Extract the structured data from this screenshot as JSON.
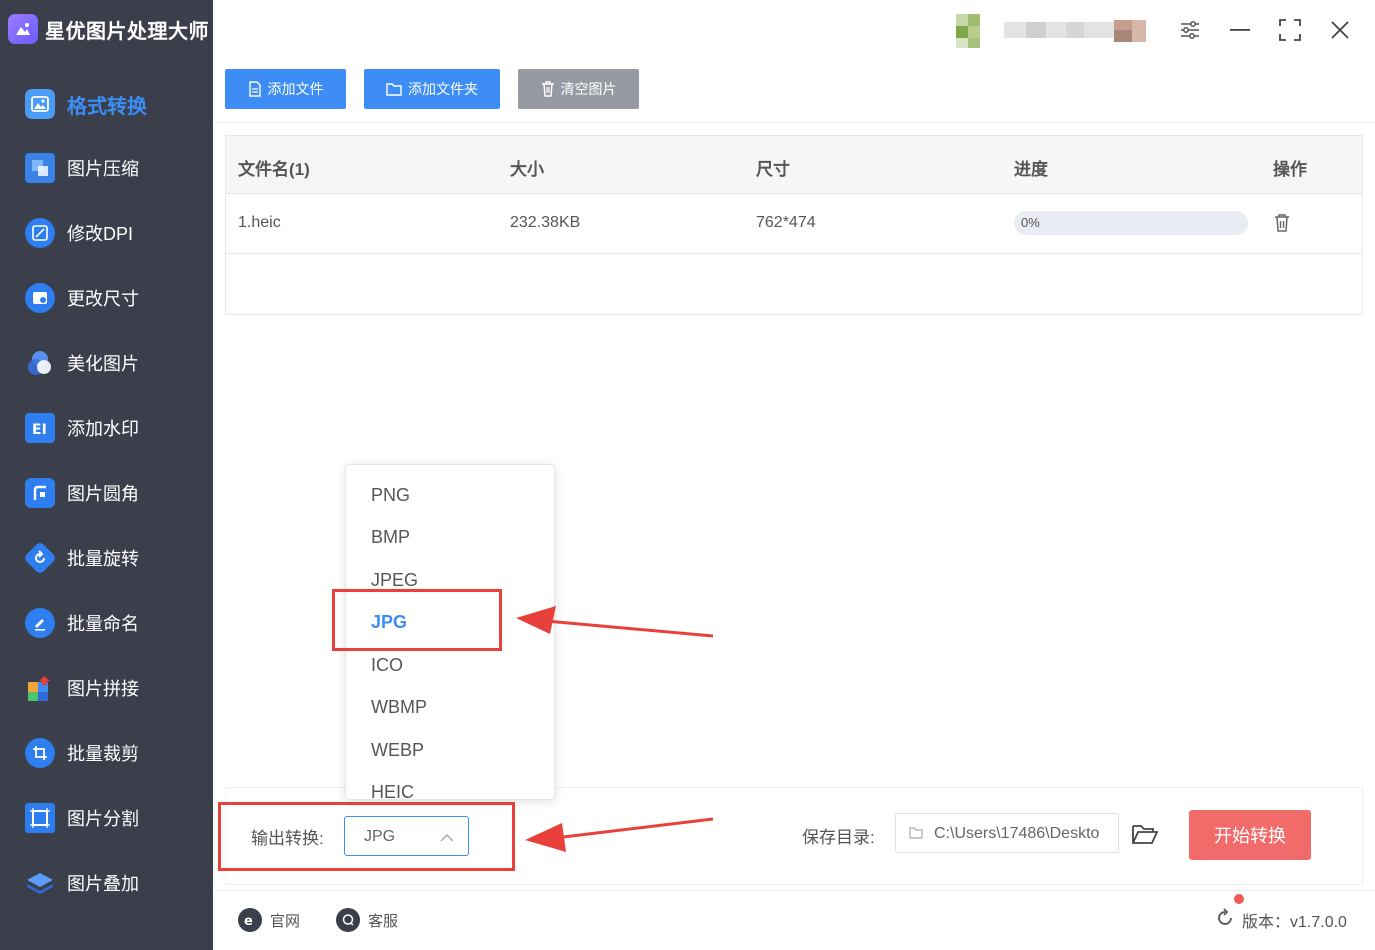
{
  "app": {
    "title": "星优图片处理大师"
  },
  "sidebar": {
    "items": [
      {
        "label": "格式转换",
        "icon": "image-convert-icon",
        "active": true
      },
      {
        "label": "图片压缩",
        "icon": "compress-icon"
      },
      {
        "label": "修改DPI",
        "icon": "dpi-icon"
      },
      {
        "label": "更改尺寸",
        "icon": "resize-icon"
      },
      {
        "label": "美化图片",
        "icon": "beautify-icon"
      },
      {
        "label": "添加水印",
        "icon": "watermark-icon"
      },
      {
        "label": "图片圆角",
        "icon": "round-corner-icon"
      },
      {
        "label": "批量旋转",
        "icon": "rotate-icon"
      },
      {
        "label": "批量命名",
        "icon": "rename-icon"
      },
      {
        "label": "图片拼接",
        "icon": "puzzle-icon"
      },
      {
        "label": "批量裁剪",
        "icon": "crop-icon"
      },
      {
        "label": "图片分割",
        "icon": "split-icon"
      },
      {
        "label": "图片叠加",
        "icon": "layers-icon"
      }
    ]
  },
  "toolbar": {
    "add_file": "添加文件",
    "add_folder": "添加文件夹",
    "clear": "清空图片"
  },
  "table": {
    "headers": {
      "name": "文件名(1)",
      "size": "大小",
      "dims": "尺寸",
      "progress": "进度",
      "action": "操作"
    },
    "rows": [
      {
        "name": "1.heic",
        "size": "232.38KB",
        "dims": "762*474",
        "progress_text": "0%",
        "progress": 0
      }
    ]
  },
  "dropdown": {
    "options": [
      "PNG",
      "BMP",
      "JPEG",
      "JPG",
      "ICO",
      "WBMP",
      "WEBP",
      "HEIC"
    ],
    "selected": "JPG"
  },
  "output": {
    "label": "输出转换:",
    "value": "JPG"
  },
  "save": {
    "label": "保存目录:",
    "path": "C:\\Users\\17486\\Deskto"
  },
  "start_button": "开始转换",
  "footer": {
    "website": "官网",
    "support": "客服",
    "version": "版本：v1.7.0.0"
  },
  "colors": {
    "sidebar_bg": "#3a3f4b",
    "accent": "#3d8df5",
    "start_btn": "#f26b6b",
    "clear_btn": "#969aa2",
    "highlight": "#e8413b"
  }
}
